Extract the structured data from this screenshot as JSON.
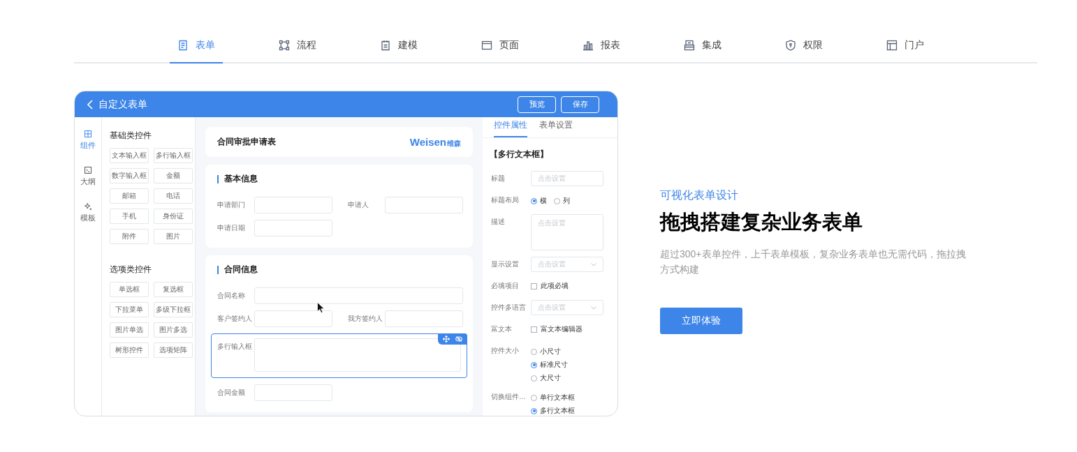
{
  "nav": [
    {
      "label": "表单",
      "selected": true
    },
    {
      "label": "流程",
      "selected": false
    },
    {
      "label": "建模",
      "selected": false
    },
    {
      "label": "页面",
      "selected": false
    },
    {
      "label": "报表",
      "selected": false
    },
    {
      "label": "集成",
      "selected": false
    },
    {
      "label": "权限",
      "selected": false
    },
    {
      "label": "门户",
      "selected": false
    }
  ],
  "editor": {
    "title": "自定义表单",
    "header_buttons": [
      "预览",
      "保存"
    ],
    "rail": [
      {
        "label": "组件",
        "selected": true
      },
      {
        "label": "大纲",
        "selected": false
      },
      {
        "label": "模板",
        "selected": false
      }
    ],
    "palette": [
      {
        "title": "基础类控件",
        "items": [
          "文本输入框",
          "多行输入框",
          "数字输入框",
          "金额",
          "邮箱",
          "电话",
          "手机",
          "身份证",
          "附件",
          "图片"
        ]
      },
      {
        "title": "选项类控件",
        "items": [
          "单选框",
          "复选框",
          "下拉菜单",
          "多级下拉框",
          "图片单选",
          "图片多选",
          "树形控件",
          "选项矩阵"
        ]
      }
    ],
    "form": {
      "title": "合同审批申请表",
      "logo": "Weisen",
      "logo_sub": "维森",
      "sections": [
        {
          "title": "基本信息",
          "rows": [
            [
              {
                "label": "申请部门",
                "kind": "input"
              },
              {
                "label": "申请人",
                "kind": "input"
              }
            ],
            [
              {
                "label": "申请日期",
                "kind": "input"
              }
            ]
          ]
        },
        {
          "title": "合同信息",
          "rows": [
            [
              {
                "label": "合同名称",
                "kind": "wide"
              }
            ],
            [
              {
                "label": "客户签约人",
                "kind": "input"
              },
              {
                "label": "我方签约人",
                "kind": "input"
              }
            ],
            [
              {
                "label": "多行输入框",
                "kind": "textarea",
                "selected": true
              }
            ],
            [
              {
                "label": "合同金额",
                "kind": "input"
              }
            ]
          ]
        }
      ]
    },
    "props": {
      "tabs": [
        {
          "label": "控件属性",
          "selected": true
        },
        {
          "label": "表单设置",
          "selected": false
        }
      ],
      "heading": "【多行文本框】",
      "rows": [
        {
          "label": "标题",
          "kind": "input",
          "placeholder": "点击设置"
        },
        {
          "label": "标题布局",
          "kind": "radio",
          "options": [
            {
              "label": "横",
              "selected": true
            },
            {
              "label": "列",
              "selected": false
            }
          ]
        },
        {
          "label": "描述",
          "kind": "textarea",
          "placeholder": "点击设置"
        },
        {
          "label": "显示设置",
          "kind": "select",
          "placeholder": "点击设置"
        },
        {
          "label": "必填项目",
          "kind": "checkbox",
          "text": "此项必填",
          "checked": false
        },
        {
          "label": "控件多语言",
          "kind": "select",
          "placeholder": "点击设置"
        },
        {
          "label": "富文本",
          "kind": "checkbox",
          "text": "富文本编辑器",
          "checked": false
        },
        {
          "label": "控件大小",
          "kind": "radio",
          "options": [
            {
              "label": "小尺寸",
              "selected": false
            },
            {
              "label": "标准尺寸",
              "selected": true
            },
            {
              "label": "大尺寸",
              "selected": false
            }
          ]
        },
        {
          "label": "切换组件…",
          "kind": "radio",
          "options": [
            {
              "label": "单行文本框",
              "selected": false
            },
            {
              "label": "多行文本框",
              "selected": true
            }
          ]
        }
      ]
    }
  },
  "hero": {
    "tagline": "可视化表单设计",
    "headline": "拖拽搭建复杂业务表单",
    "description": "超过300+表单控件，上千表单模板，复杂业务表单也无需代码，拖拉拽方式构建",
    "button": "立即体验"
  }
}
